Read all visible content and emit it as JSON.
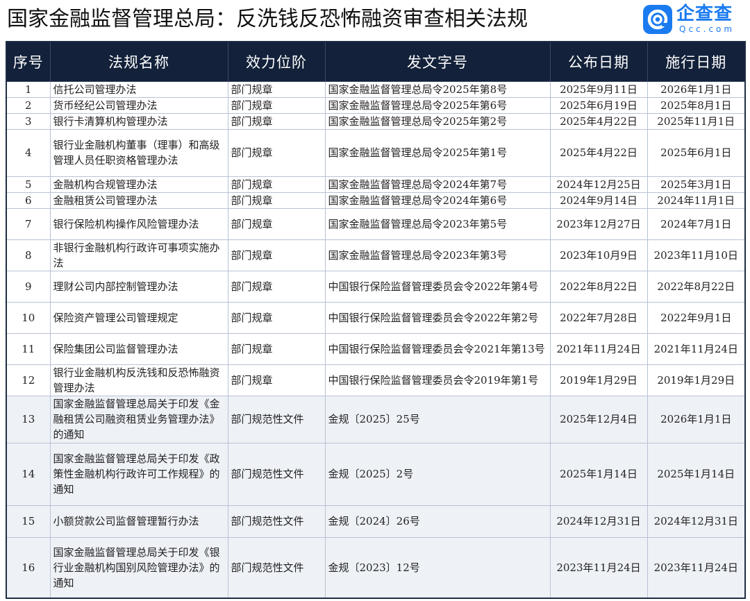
{
  "title": "国家金融监督管理总局：反洗钱反恐怖融资审查相关法规",
  "logo": {
    "name": "企查查",
    "sub": "Qcc.com",
    "accent": "#1a7bf0"
  },
  "colors": {
    "header_bg": "#13213a",
    "header_text": "#ffffff",
    "alt_row": "#eef1f6"
  },
  "columns": [
    "序号",
    "法规名称",
    "效力位阶",
    "发文字号",
    "公布日期",
    "施行日期"
  ],
  "rows": [
    {
      "no": "1",
      "name": "信托公司管理办法",
      "rank": "部门规章",
      "doc": "国家金融监督管理总局令2025年第8号",
      "pub": "2025年9月11日",
      "eff": "2026年1月1日"
    },
    {
      "no": "2",
      "name": "货币经纪公司管理办法",
      "rank": "部门规章",
      "doc": "国家金融监督管理总局令2025年第6号",
      "pub": "2025年6月19日",
      "eff": "2025年8月1日"
    },
    {
      "no": "3",
      "name": "银行卡清算机构管理办法",
      "rank": "部门规章",
      "doc": "国家金融监督管理总局令2025年第2号",
      "pub": "2025年4月22日",
      "eff": "2025年11月1日"
    },
    {
      "no": "4",
      "name": "银行业金融机构董事（理事）和高级管理人员任职资格管理办法",
      "rank": "部门规章",
      "doc": "国家金融监督管理总局令2025年第1号",
      "pub": "2025年4月22日",
      "eff": "2025年6月1日"
    },
    {
      "no": "5",
      "name": "金融机构合规管理办法",
      "rank": "部门规章",
      "doc": "国家金融监督管理总局令2024年第7号",
      "pub": "2024年12月25日",
      "eff": "2025年3月1日"
    },
    {
      "no": "6",
      "name": "金融租赁公司管理办法",
      "rank": "部门规章",
      "doc": "国家金融监督管理总局令2024年第6号",
      "pub": "2024年9月14日",
      "eff": "2024年11月1日"
    },
    {
      "no": "7",
      "name": "银行保险机构操作风险管理办法",
      "rank": "部门规章",
      "doc": "国家金融监督管理总局令2023年第5号",
      "pub": "2023年12月27日",
      "eff": "2024年7月1日"
    },
    {
      "no": "8",
      "name": "非银行金融机构行政许可事项实施办法",
      "rank": "部门规章",
      "doc": "国家金融监督管理总局令2023年第3号",
      "pub": "2023年10月9日",
      "eff": "2023年11月10日"
    },
    {
      "no": "9",
      "name": "理财公司内部控制管理办法",
      "rank": "部门规章",
      "doc": "中国银行保险监督管理委员会令2022年第4号",
      "pub": "2022年8月22日",
      "eff": "2022年8月22日"
    },
    {
      "no": "10",
      "name": "保险资产管理公司管理规定",
      "rank": "部门规章",
      "doc": "中国银行保险监督管理委员会令2022年第2号",
      "pub": "2022年7月28日",
      "eff": "2022年9月1日"
    },
    {
      "no": "11",
      "name": "保险集团公司监督管理办法",
      "rank": "部门规章",
      "doc": "中国银行保险监督管理委员会令2021年第13号",
      "pub": "2021年11月24日",
      "eff": "2021年11月24日"
    },
    {
      "no": "12",
      "name": "银行业金融机构反洗钱和反恐怖融资管理办法",
      "rank": "部门规章",
      "doc": "中国银行保险监督管理委员会令2019年第1号",
      "pub": "2019年1月29日",
      "eff": "2019年1月29日"
    },
    {
      "no": "13",
      "name": "国家金融监督管理总局关于印发《金融租赁公司融资租赁业务管理办法》的通知",
      "rank": "部门规范性文件",
      "doc": "金规〔2025〕25号",
      "pub": "2025年12月4日",
      "eff": "2026年1月1日"
    },
    {
      "no": "14",
      "name": "国家金融监督管理总局关于印发《政策性金融机构行政许可工作规程》的通知",
      "rank": "部门规范性文件",
      "doc": "金规〔2025〕2号",
      "pub": "2025年1月14日",
      "eff": "2025年1月14日"
    },
    {
      "no": "15",
      "name": "小额贷款公司监督管理暂行办法",
      "rank": "部门规范性文件",
      "doc": "金规〔2024〕26号",
      "pub": "2024年12月31日",
      "eff": "2024年12月31日"
    },
    {
      "no": "16",
      "name": "国家金融监督管理总局关于印发《银行业金融机构国别风险管理办法》的通知",
      "rank": "部门规范性文件",
      "doc": "金规〔2023〕12号",
      "pub": "2023年11月24日",
      "eff": "2023年11月24日"
    }
  ]
}
